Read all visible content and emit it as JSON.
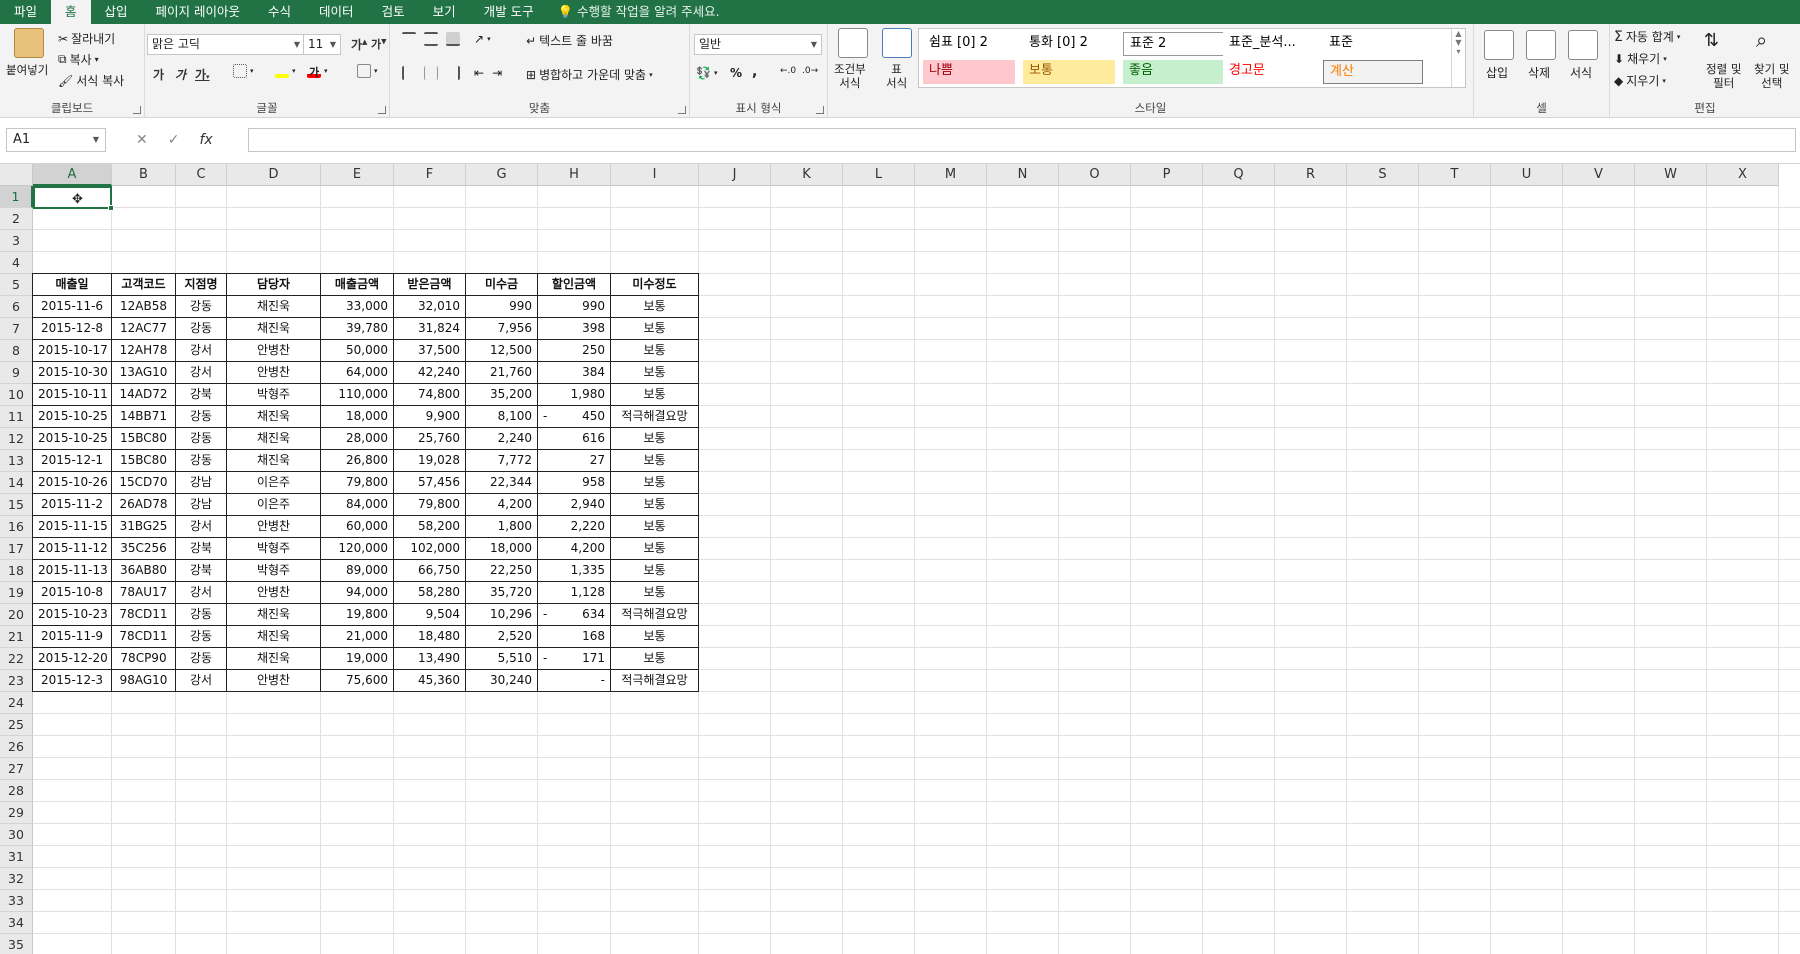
{
  "tabs": [
    "파일",
    "홈",
    "삽입",
    "페이지 레이아웃",
    "수식",
    "데이터",
    "검토",
    "보기",
    "개발 도구"
  ],
  "active_tab": "홈",
  "tell_me": "수행할 작업을 알려 주세요.",
  "clipboard": {
    "paste": "붙여넣기",
    "cut": "잘라내기",
    "copy": "복사",
    "format_painter": "서식 복사",
    "label": "클립보드"
  },
  "font": {
    "name": "맑은 고딕",
    "size": "11",
    "bold": "가",
    "italic": "가",
    "underline": "가",
    "grow": "가",
    "shrink": "가",
    "label": "글꼴"
  },
  "alignment": {
    "wrap": "텍스트 줄 바꿈",
    "merge": "병합하고 가운데 맞춤",
    "label": "맞춤"
  },
  "number": {
    "format": "일반",
    "percent": "%",
    "comma": ",",
    "label": "표시 형식"
  },
  "styles": {
    "conditional": "조건부\n서식",
    "table": "표\n서식",
    "gallery": [
      {
        "text": "쉼표 [0] 2",
        "bg": "#ffffff",
        "fg": "#000000"
      },
      {
        "text": "통화 [0] 2",
        "bg": "#ffffff",
        "fg": "#000000"
      },
      {
        "text": "표준 2",
        "bg": "#ffffff",
        "fg": "#000000"
      },
      {
        "text": "표준_분석...",
        "bg": "#ffffff",
        "fg": "#000000"
      },
      {
        "text": "표준",
        "bg": "#ffffff",
        "fg": "#000000"
      },
      {
        "text": "나쁨",
        "bg": "#ffc7ce",
        "fg": "#9c0006"
      },
      {
        "text": "보통",
        "bg": "#ffeb9c",
        "fg": "#9c5700"
      },
      {
        "text": "좋음",
        "bg": "#c6efce",
        "fg": "#006100"
      },
      {
        "text": "경고문",
        "bg": "#ffffff",
        "fg": "#ff0000"
      },
      {
        "text": "계산",
        "bg": "#f2f2f2",
        "fg": "#fa7d00"
      }
    ],
    "label": "스타일"
  },
  "cells_group": {
    "insert": "삽입",
    "delete": "삭제",
    "format": "서식",
    "label": "셀"
  },
  "editing": {
    "autosum": "자동 합계",
    "fill": "채우기",
    "clear": "지우기",
    "sort": "정렬 및\n필터",
    "find": "찾기 및\n선택",
    "label": "편집"
  },
  "name_box": "A1",
  "columns": [
    "A",
    "B",
    "C",
    "D",
    "E",
    "F",
    "G",
    "H",
    "I",
    "J",
    "K",
    "L",
    "M",
    "N",
    "O",
    "P",
    "Q",
    "R",
    "S",
    "T",
    "U",
    "V",
    "W",
    "X"
  ],
  "row_count": 35,
  "table": {
    "headers": [
      "매출일",
      "고객코드",
      "지점명",
      "담당자",
      "매출금액",
      "받은금액",
      "미수금",
      "할인금액",
      "미수정도"
    ],
    "rows": [
      [
        "2015-11-6",
        "12AB58",
        "강동",
        "채진욱",
        "33,000",
        "32,010",
        "990",
        "990",
        "보통"
      ],
      [
        "2015-12-8",
        "12AC77",
        "강동",
        "채진욱",
        "39,780",
        "31,824",
        "7,956",
        "398",
        "보통"
      ],
      [
        "2015-10-17",
        "12AH78",
        "강서",
        "안병찬",
        "50,000",
        "37,500",
        "12,500",
        "250",
        "보통"
      ],
      [
        "2015-10-30",
        "13AG10",
        "강서",
        "안병찬",
        "64,000",
        "42,240",
        "21,760",
        "384",
        "보통"
      ],
      [
        "2015-10-11",
        "14AD72",
        "강북",
        "박형주",
        "110,000",
        "74,800",
        "35,200",
        "1,980",
        "보통"
      ],
      [
        "2015-10-25",
        "14BB71",
        "강동",
        "채진욱",
        "18,000",
        "9,900",
        "8,100",
        "- 450",
        "적극해결요망"
      ],
      [
        "2015-10-25",
        "15BC80",
        "강동",
        "채진욱",
        "28,000",
        "25,760",
        "2,240",
        "616",
        "보통"
      ],
      [
        "2015-12-1",
        "15BC80",
        "강동",
        "채진욱",
        "26,800",
        "19,028",
        "7,772",
        "27",
        "보통"
      ],
      [
        "2015-10-26",
        "15CD70",
        "강남",
        "이은주",
        "79,800",
        "57,456",
        "22,344",
        "958",
        "보통"
      ],
      [
        "2015-11-2",
        "26AD78",
        "강남",
        "이은주",
        "84,000",
        "79,800",
        "4,200",
        "2,940",
        "보통"
      ],
      [
        "2015-11-15",
        "31BG25",
        "강서",
        "안병찬",
        "60,000",
        "58,200",
        "1,800",
        "2,220",
        "보통"
      ],
      [
        "2015-11-12",
        "35C256",
        "강북",
        "박형주",
        "120,000",
        "102,000",
        "18,000",
        "4,200",
        "보통"
      ],
      [
        "2015-11-13",
        "36AB80",
        "강북",
        "박형주",
        "89,000",
        "66,750",
        "22,250",
        "1,335",
        "보통"
      ],
      [
        "2015-10-8",
        "78AU17",
        "강서",
        "안병찬",
        "94,000",
        "58,280",
        "35,720",
        "1,128",
        "보통"
      ],
      [
        "2015-10-23",
        "78CD11",
        "강동",
        "채진욱",
        "19,800",
        "9,504",
        "10,296",
        "- 634",
        "적극해결요망"
      ],
      [
        "2015-11-9",
        "78CD11",
        "강동",
        "채진욱",
        "21,000",
        "18,480",
        "2,520",
        "168",
        "보통"
      ],
      [
        "2015-12-20",
        "78CP90",
        "강동",
        "채진욱",
        "19,000",
        "13,490",
        "5,510",
        "- 171",
        "보통"
      ],
      [
        "2015-12-3",
        "98AG10",
        "강서",
        "안병찬",
        "75,600",
        "45,360",
        "30,240",
        "-",
        "적극해결요망"
      ]
    ]
  }
}
